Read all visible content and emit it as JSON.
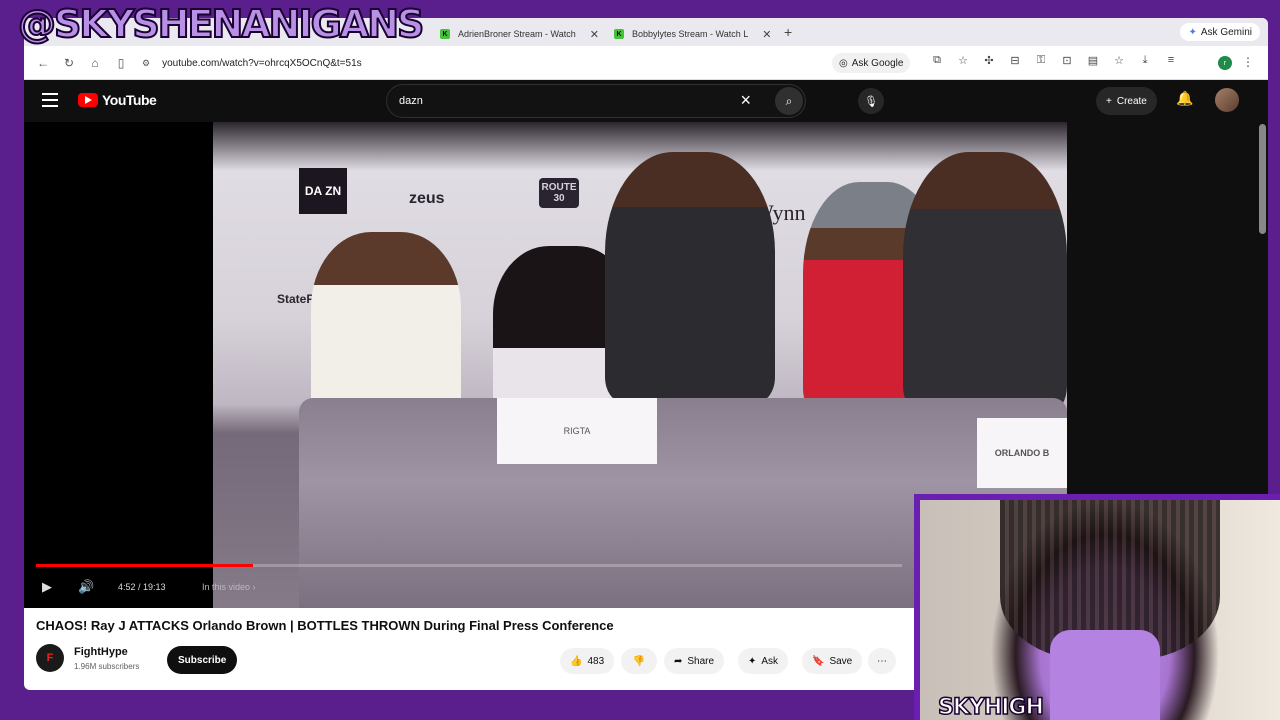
{
  "overlay": {
    "handle": "@SKYSHENANIGANS",
    "cam_label": "SKYHIGH"
  },
  "browser": {
    "tabs": [
      {
        "favicon": "K",
        "title": "AdrienBroner Stream - Watch",
        "close": "✕"
      },
      {
        "favicon": "K",
        "title": "Bobbylytes Stream - Watch L",
        "close": "✕"
      }
    ],
    "new_tab": "+",
    "ask_gemini": "Ask Gemini",
    "url": "youtube.com/watch?v=ohrcqX5OCnQ&t=51s",
    "ask_google": "Ask Google",
    "profile_initial": "r"
  },
  "youtube": {
    "logo_text": "YouTube",
    "search_query": "dazn",
    "create_label": "Create",
    "video": {
      "current_time": "4:52",
      "duration": "19:13",
      "time_display": "4:52 / 19:13",
      "chapter_hint": "In this video ›",
      "progress_fraction": 0.25,
      "backdrop": {
        "dazn": "DA ZN",
        "zeus": "zeus",
        "statefarm": "StateFarm ARENA",
        "wynn": "Wynn",
        "route30": "ROUTE 30",
        "nameplate_left": "RIGTA",
        "nameplate_right": "ORLANDO B"
      }
    },
    "title": "CHAOS! Ray J ATTACKS Orlando Brown | BOTTLES THROWN During Final Press Conference",
    "channel": {
      "name": "FightHype",
      "subscribers": "1.96M subscribers",
      "avatar_letter": "F"
    },
    "subscribe_label": "Subscribe",
    "actions": {
      "likes": "483",
      "share": "Share",
      "ask": "Ask",
      "save": "Save"
    }
  }
}
